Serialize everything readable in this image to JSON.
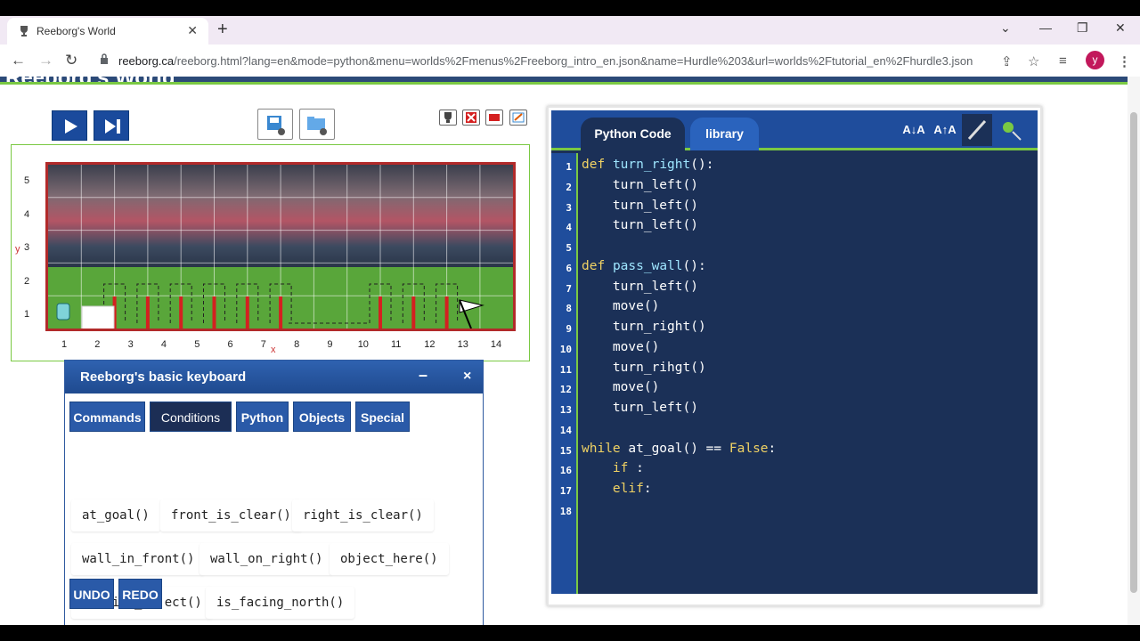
{
  "browser": {
    "tab_title": "Reeborg's World",
    "url_host": "reeborg.ca",
    "url_path": "/reeborg.html?lang=en&mode=python&menu=worlds%2Fmenus%2Freeborg_intro_en.json&name=Hurdle%203&url=worlds%2Ftutorial_en%2Fhurdle3.json",
    "avatar_letter": "y",
    "avatar_color": "#c2185b"
  },
  "page": {
    "banner_title": "Reeborg's World"
  },
  "world": {
    "x_labels": [
      "1",
      "2",
      "3",
      "4",
      "5",
      "6",
      "7",
      "8",
      "9",
      "10",
      "11",
      "12",
      "13",
      "14"
    ],
    "y_labels": [
      "1",
      "2",
      "3",
      "4",
      "5"
    ],
    "x_axis_letter": "x",
    "y_axis_letter": "y",
    "wall_color": "#d42020",
    "border_color": "#b22a2a"
  },
  "keyboard": {
    "title": "Reeborg's basic keyboard",
    "minimize": "–",
    "close": "×",
    "tabs": [
      "Commands",
      "Conditions",
      "Python",
      "Objects",
      "Special"
    ],
    "active_tab": "Conditions",
    "commands": [
      [
        "at_goal()",
        "front_is_clear()",
        "right_is_clear()"
      ],
      [
        "wall_in_front()",
        "wall_on_right()",
        "object_here()"
      ],
      [
        "carries_object()",
        "is_facing_north()"
      ]
    ],
    "undo": "UNDO",
    "redo": "REDO"
  },
  "editor": {
    "tabs": [
      "Python Code",
      "library"
    ],
    "active_tab": "Python Code",
    "tools": [
      "A↓A",
      "A↑A"
    ],
    "line_numbers": [
      "1",
      "2",
      "3",
      "4",
      "5",
      "6",
      "7",
      "8",
      "9",
      "10",
      "11",
      "12",
      "13",
      "14",
      "15",
      "16",
      "17",
      "18"
    ],
    "lines": [
      "def turn_right():",
      "    turn_left()",
      "    turn_left()",
      "    turn_left()",
      "",
      "def pass_wall():",
      "    turn_left()",
      "    move()",
      "    turn_right()",
      "    move()",
      "    turn_rihgt()",
      "    move()",
      "    turn_left()",
      "",
      "while at_goal() == False:",
      "    if :",
      "    elif:",
      ""
    ]
  }
}
